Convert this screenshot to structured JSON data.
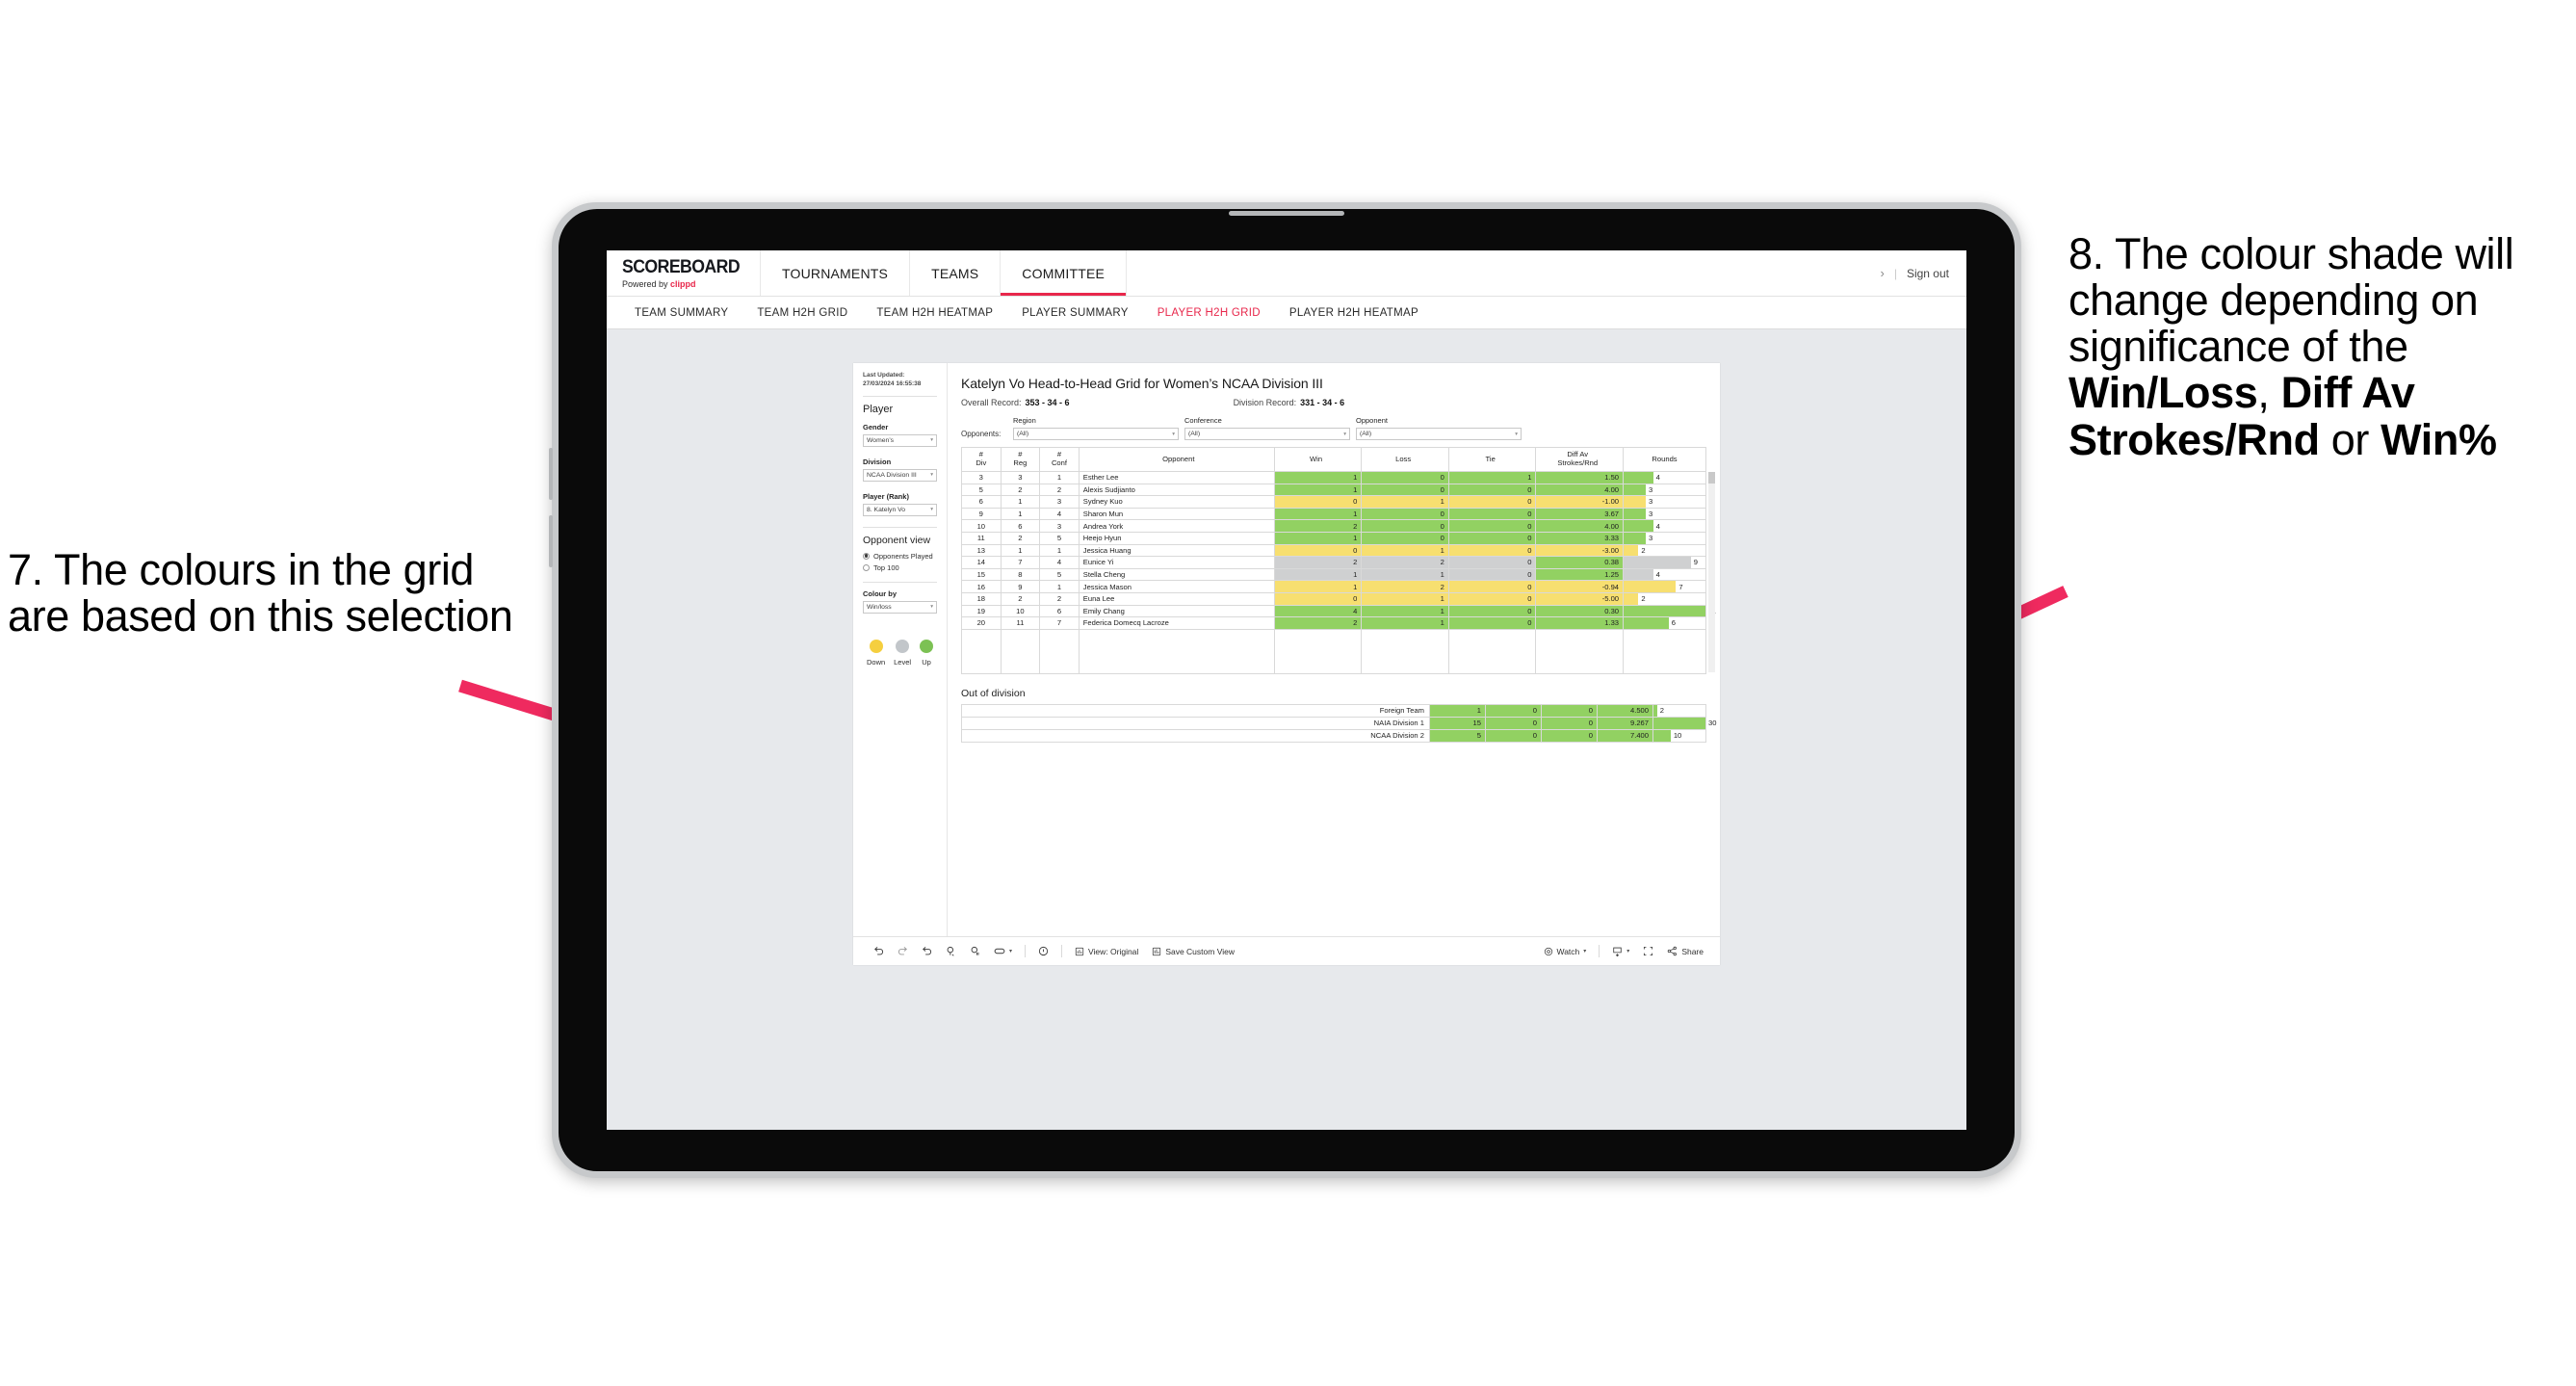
{
  "annotations": {
    "left": "7. The colours in the grid are based on this selection",
    "right_parts": [
      {
        "text": "8. The colour shade will change depending on significance of the ",
        "bold": false
      },
      {
        "text": "Win/Loss",
        "bold": true
      },
      {
        "text": ", ",
        "bold": false
      },
      {
        "text": "Diff Av Strokes/Rnd",
        "bold": true
      },
      {
        "text": " or ",
        "bold": false
      },
      {
        "text": "Win%",
        "bold": true
      }
    ],
    "arrow_color": "#ef2a5f"
  },
  "header": {
    "logo_word": "SCOREBOARD",
    "logo_sub_prefix": "Powered by ",
    "logo_brand": "clippd",
    "nav": [
      {
        "label": "TOURNAMENTS",
        "active": false
      },
      {
        "label": "TEAMS",
        "active": false
      },
      {
        "label": "COMMITTEE",
        "active": true
      }
    ],
    "chevron": "›",
    "divider": "|",
    "sign_out": "Sign out"
  },
  "subnav": [
    {
      "label": "TEAM SUMMARY",
      "active": false
    },
    {
      "label": "TEAM H2H GRID",
      "active": false
    },
    {
      "label": "TEAM H2H HEATMAP",
      "active": false
    },
    {
      "label": "PLAYER SUMMARY",
      "active": false
    },
    {
      "label": "PLAYER H2H GRID",
      "active": true
    },
    {
      "label": "PLAYER H2H HEATMAP",
      "active": false
    }
  ],
  "sidebar": {
    "last_updated": "Last Updated: 27/03/2024 16:55:38",
    "player_heading": "Player",
    "gender": {
      "label": "Gender",
      "value": "Women’s"
    },
    "division": {
      "label": "Division",
      "value": "NCAA Division III"
    },
    "player_rank": {
      "label": "Player (Rank)",
      "value": "8. Katelyn Vo"
    },
    "opponent_view": {
      "heading": "Opponent view",
      "options": [
        {
          "label": "Opponents Played",
          "selected": true
        },
        {
          "label": "Top 100",
          "selected": false
        }
      ]
    },
    "colour_by": {
      "label": "Colour by",
      "value": "Win/loss"
    },
    "legend": [
      {
        "label": "Down",
        "color": "#f5cf3f"
      },
      {
        "label": "Level",
        "color": "#c2c6ca"
      },
      {
        "label": "Up",
        "color": "#7cc154"
      }
    ],
    "caret": "▾"
  },
  "main": {
    "title": "Katelyn Vo Head-to-Head Grid for Women’s NCAA Division III",
    "overall_record": {
      "label": "Overall Record:",
      "value": "353 -  34 - 6"
    },
    "division_record": {
      "label": "Division Record:",
      "value": "331 -  34 - 6"
    },
    "opponents_label": "Opponents:",
    "filters": [
      {
        "label": "Region",
        "value": "(All)"
      },
      {
        "label": "Conference",
        "value": "(All)"
      },
      {
        "label": "Opponent",
        "value": "(All)"
      }
    ],
    "columns": [
      {
        "line1": "#",
        "line2": "Div"
      },
      {
        "line1": "#",
        "line2": "Reg"
      },
      {
        "line1": "#",
        "line2": "Conf"
      },
      {
        "line1": "Opponent",
        "line2": ""
      },
      {
        "line1": "Win",
        "line2": ""
      },
      {
        "line1": "Loss",
        "line2": ""
      },
      {
        "line1": "Tie",
        "line2": ""
      },
      {
        "line1": "Diff Av",
        "line2": "Strokes/Rnd"
      },
      {
        "line1": "Rounds",
        "line2": ""
      }
    ],
    "rows": [
      {
        "div": "3",
        "reg": "3",
        "conf": "1",
        "opponent": "Esther Lee",
        "win": "1",
        "loss": "0",
        "tie": "1",
        "diff": "1.50",
        "rounds": "4",
        "shade": "g",
        "bar_pct": 36
      },
      {
        "div": "5",
        "reg": "2",
        "conf": "2",
        "opponent": "Alexis Sudjianto",
        "win": "1",
        "loss": "0",
        "tie": "0",
        "diff": "4.00",
        "rounds": "3",
        "shade": "g",
        "bar_pct": 27
      },
      {
        "div": "6",
        "reg": "1",
        "conf": "3",
        "opponent": "Sydney Kuo",
        "win": "0",
        "loss": "1",
        "tie": "0",
        "diff": "-1.00",
        "rounds": "3",
        "shade": "y",
        "bar_pct": 27
      },
      {
        "div": "9",
        "reg": "1",
        "conf": "4",
        "opponent": "Sharon Mun",
        "win": "1",
        "loss": "0",
        "tie": "0",
        "diff": "3.67",
        "rounds": "3",
        "shade": "g",
        "bar_pct": 27
      },
      {
        "div": "10",
        "reg": "6",
        "conf": "3",
        "opponent": "Andrea York",
        "win": "2",
        "loss": "0",
        "tie": "0",
        "diff": "4.00",
        "rounds": "4",
        "shade": "g",
        "bar_pct": 36
      },
      {
        "div": "11",
        "reg": "2",
        "conf": "5",
        "opponent": "Heejo Hyun",
        "win": "1",
        "loss": "0",
        "tie": "0",
        "diff": "3.33",
        "rounds": "3",
        "shade": "g",
        "bar_pct": 27
      },
      {
        "div": "13",
        "reg": "1",
        "conf": "1",
        "opponent": "Jessica Huang",
        "win": "0",
        "loss": "1",
        "tie": "0",
        "diff": "-3.00",
        "rounds": "2",
        "shade": "y",
        "bar_pct": 18
      },
      {
        "div": "14",
        "reg": "7",
        "conf": "4",
        "opponent": "Eunice Yi",
        "win": "2",
        "loss": "2",
        "tie": "0",
        "diff": "0.38",
        "rounds": "9",
        "shade": "n",
        "diff_shade": "g",
        "bar_pct": 82
      },
      {
        "div": "15",
        "reg": "8",
        "conf": "5",
        "opponent": "Stella Cheng",
        "win": "1",
        "loss": "1",
        "tie": "0",
        "diff": "1.25",
        "rounds": "4",
        "shade": "n",
        "diff_shade": "g",
        "bar_pct": 36
      },
      {
        "div": "16",
        "reg": "9",
        "conf": "1",
        "opponent": "Jessica Mason",
        "win": "1",
        "loss": "2",
        "tie": "0",
        "diff": "-0.94",
        "rounds": "7",
        "shade": "y",
        "bar_pct": 64
      },
      {
        "div": "18",
        "reg": "2",
        "conf": "2",
        "opponent": "Euna Lee",
        "win": "0",
        "loss": "1",
        "tie": "0",
        "diff": "-5.00",
        "rounds": "2",
        "shade": "y",
        "bar_pct": 18
      },
      {
        "div": "19",
        "reg": "10",
        "conf": "6",
        "opponent": "Emily Chang",
        "win": "4",
        "loss": "1",
        "tie": "0",
        "diff": "0.30",
        "rounds": "11",
        "shade": "g",
        "bar_pct": 100
      },
      {
        "div": "20",
        "reg": "11",
        "conf": "7",
        "opponent": "Federica Domecq Lacroze",
        "win": "2",
        "loss": "1",
        "tie": "0",
        "diff": "1.33",
        "rounds": "6",
        "shade": "g",
        "bar_pct": 55
      }
    ],
    "out_of_division": {
      "title": "Out of division",
      "rows": [
        {
          "name": "Foreign Team",
          "win": "1",
          "loss": "0",
          "tie": "0",
          "diff": "4.500",
          "rounds": "2",
          "shade": "g",
          "bar_pct": 7
        },
        {
          "name": "NAIA Division 1",
          "win": "15",
          "loss": "0",
          "tie": "0",
          "diff": "9.267",
          "rounds": "30",
          "shade": "g",
          "bar_pct": 100
        },
        {
          "name": "NCAA Division 2",
          "win": "5",
          "loss": "0",
          "tie": "0",
          "diff": "7.400",
          "rounds": "10",
          "shade": "g",
          "bar_pct": 33
        }
      ]
    }
  },
  "toolbar": {
    "items": [
      {
        "name": "undo-icon",
        "label": ""
      },
      {
        "name": "redo-icon",
        "label": ""
      },
      {
        "name": "revert-icon",
        "label": ""
      },
      {
        "name": "refresh-icon",
        "label": ""
      },
      {
        "name": "pause-icon",
        "label": ""
      },
      {
        "name": "shape-icon",
        "label": "",
        "caret": true
      }
    ],
    "alert_icon": "alert-icon",
    "view_original": "View: Original",
    "save_custom_view": "Save Custom View",
    "watch": "Watch",
    "share": "Share",
    "caret": "▾"
  },
  "colors": {
    "brand_pink": "#e8274b",
    "green": "#92d162",
    "yellow": "#f7df70",
    "grey": "#cfd0d1"
  }
}
